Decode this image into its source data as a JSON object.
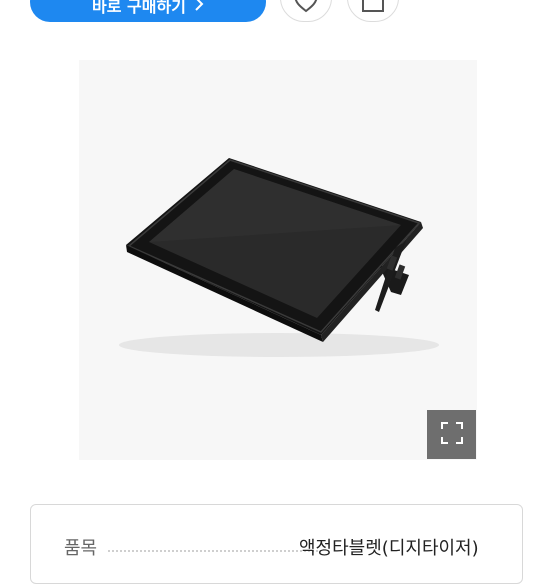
{
  "actions": {
    "cta_label": "바로 구매하기",
    "cta_icon": "chevron-right-icon",
    "favorite_icon": "heart-icon",
    "share_icon": "share-icon"
  },
  "product": {
    "image": "pen-display-tablet-image",
    "expand_icon": "expand-icon"
  },
  "specs": [
    {
      "key": "품목",
      "value": "액정타블렛(디지타이저)"
    }
  ]
}
